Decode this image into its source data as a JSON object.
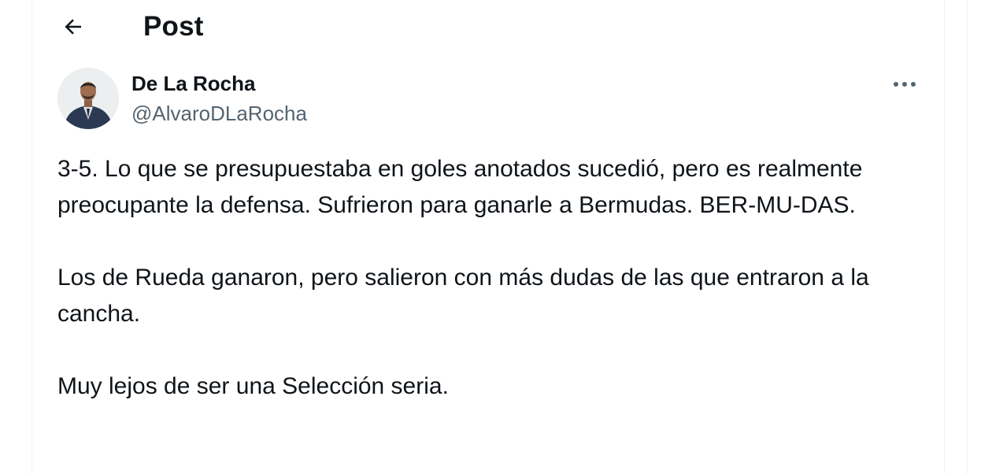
{
  "header": {
    "title": "Post",
    "back_icon": "arrow-left-icon"
  },
  "author": {
    "name": "De La Rocha",
    "handle": "@AlvaroDLaRocha",
    "avatar_icon": "avatar-photo"
  },
  "more_icon": "more-horizontal-icon",
  "tweet": {
    "paragraphs": [
      "3-5. Lo que se presupuestaba en goles anotados sucedió, pero es realmente preocupante la defensa. Sufrieron para ganarle a Bermudas. BER-MU-DAS.",
      "Los de Rueda ganaron, pero salieron con más dudas de las que entraron a la cancha.",
      "Muy lejos de ser una Selección seria."
    ]
  },
  "colors": {
    "text": "#0f1419",
    "secondary": "#536471",
    "border": "#eff3f4"
  }
}
